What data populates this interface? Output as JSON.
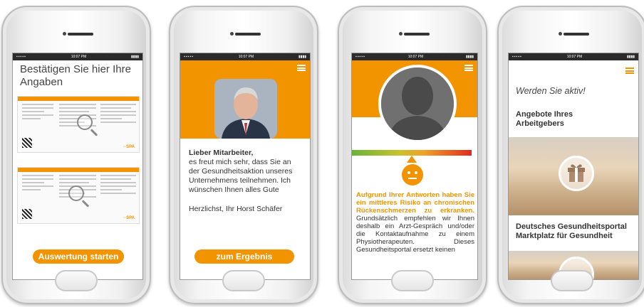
{
  "status": {
    "time": "10:07 PM",
    "signal": "▪▪▪▪▪",
    "battery": "▮▮▮▮"
  },
  "screen1": {
    "title": "Bestätigen Sie hier Ihre Angaben",
    "button": "Auswertung starten"
  },
  "screen2": {
    "greeting": "Lieber Mitarbeiter,",
    "body": "es freut mich sehr, dass Sie an der Gesundheitsaktion unseres Unternehmens teilnehmen. Ich wünschen Ihnen alles Gute",
    "signature": "Herzlichst, Ihr Horst Schäfer",
    "button": "zum Ergebnis"
  },
  "screen3": {
    "highlight": "Aufgrund Ihrer Antworten haben Sie ein mittleres Risiko an chronischen Rückenschmerzen zu erkranken.",
    "body": "Grundsätzlich empfehlen wir Ihnen deshalb ein Arzt-Gespräch und/oder die Kontaktaufnahme zu einem Physiotherapeuten. Dieses Gesundheitsportal ersetzt keinen"
  },
  "screen4": {
    "title": "Werden Sie aktiv!",
    "section1": "Angebote Ihres Arbeitgebers",
    "section2": "Deutsches Gesundheitsportal Marktplatz für Gesundheit"
  },
  "colors": {
    "accent": "#f29400",
    "dark": "#2b2b2b"
  }
}
